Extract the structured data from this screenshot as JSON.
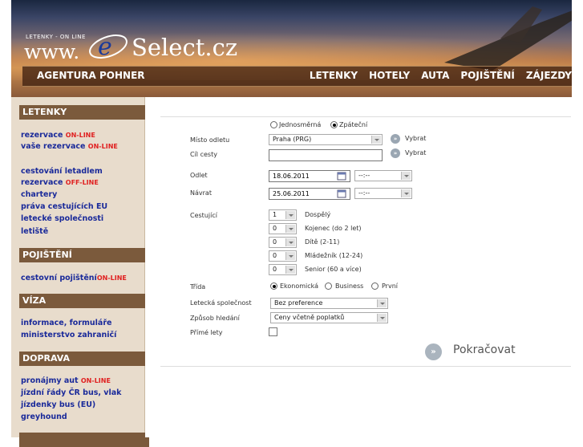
{
  "header": {
    "logo_small": "LETENKY - ON LINE",
    "logo_www": "www.",
    "logo_e": "e",
    "logo_select": "Select.cz",
    "agency": "AGENTURA POHNER",
    "nav": [
      "LETENKY",
      "HOTELY",
      "AUTA",
      "POJIŠTĚNÍ",
      "ZÁJEZDY"
    ]
  },
  "sidebar": {
    "sections": [
      {
        "title": "LETENKY"
      },
      {
        "title": "POJIŠTĚNÍ"
      },
      {
        "title": "VÍZA"
      },
      {
        "title": "DOPRAVA"
      }
    ],
    "links": {
      "rezervace": "rezervace",
      "vase_rezervace": "vaše rezervace",
      "cestovani": "cestování letadlem",
      "rezervace_off": "rezervace",
      "chartery": "chartery",
      "prava": "práva cestujících EU",
      "spolecnosti": "letecké společnosti",
      "letiste": "letiště",
      "pojisteni": "cestovní pojištění",
      "informace": "informace, formuláře",
      "ministerstvo": "ministerstvo zahraničí",
      "pronajmy": "pronájmy aut",
      "jizdni": "jízdní řády ČR bus, vlak",
      "jizdenky": "jízdenky bus (EU)",
      "greyhound": "greyhound"
    },
    "online": "ON-LINE",
    "offline": "OFF-LINE"
  },
  "form": {
    "trip_one_way": "Jednosměrná",
    "trip_return": "Zpáteční",
    "origin_label": "Místo odletu",
    "origin_value": "Praha (PRG)",
    "select_label": "Vybrat",
    "destination_label": "Cíl cesty",
    "destination_value": "",
    "depart_label": "Odlet",
    "depart_date": "18.06.2011",
    "return_label": "Návrat",
    "return_date": "25.06.2011",
    "time_placeholder": "--:--",
    "passengers_label": "Cestující",
    "passengers": [
      {
        "count": "1",
        "label": "Dospělý"
      },
      {
        "count": "0",
        "label": "Kojenec (do 2 let)"
      },
      {
        "count": "0",
        "label": "Dítě (2-11)"
      },
      {
        "count": "0",
        "label": "Mládežník (12-24)"
      },
      {
        "count": "0",
        "label": "Senior (60 a více)"
      }
    ],
    "class_label": "Třída",
    "class_options": [
      "Ekonomická",
      "Business",
      "První"
    ],
    "airline_label": "Letecká společnost",
    "airline_value": "Bez preference",
    "search_label": "Způsob hledání",
    "search_value": "Ceny včetně poplatků",
    "direct_label": "Přímé lety",
    "continue": "Pokračovat"
  }
}
